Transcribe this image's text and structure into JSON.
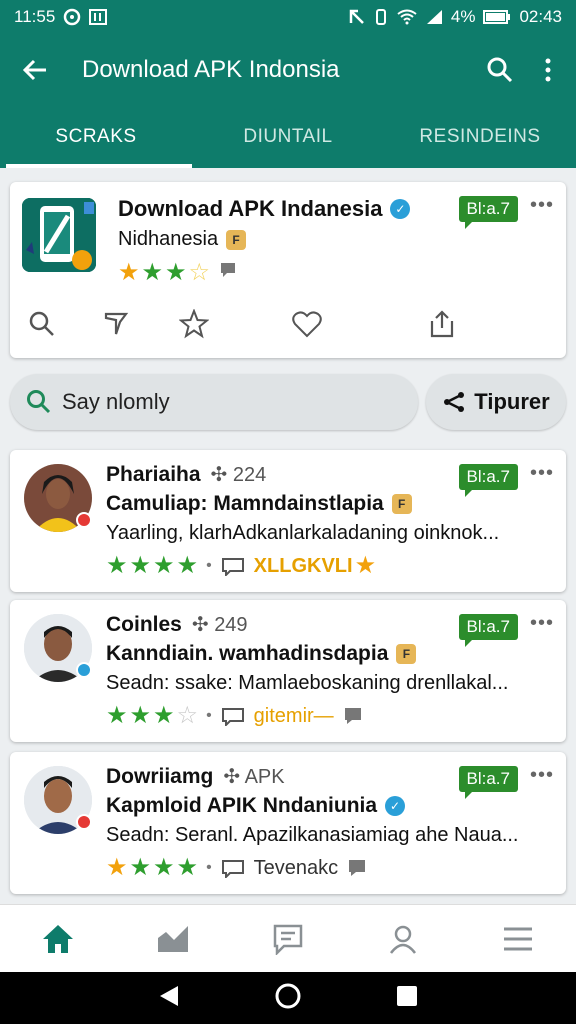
{
  "status_bar": {
    "time": "11:55",
    "battery": "4%",
    "clock": "02:43"
  },
  "app_bar": {
    "title": "Download APK Indonsia"
  },
  "tabs": [
    {
      "label": "SCRAKS",
      "active": true
    },
    {
      "label": "DIUNTAIL",
      "active": false
    },
    {
      "label": "RESINDEINS",
      "active": false
    }
  ],
  "app_card": {
    "title": "Download APK Indanesia",
    "subtitle": "Nidhanesia",
    "price": "Bl:a.7",
    "rating": 3.5
  },
  "search": {
    "value": "Say nlomly"
  },
  "share": {
    "label": "Tipurer"
  },
  "reviews": [
    {
      "name": "Phariaiha",
      "meta": "224",
      "title": "Camuliap: Mamndainstlapia",
      "text": "Yaarling, klarhAdkanlarkaladaning oinknok...",
      "rating": 4,
      "extra": "XLLGKVLI",
      "price": "Bl:a.7"
    },
    {
      "name": "Coinles",
      "meta": "249",
      "title": "Kanndiain. wamhadinsdapia",
      "text": "Seadn: ssake: Mamlaeboskaning drenllakal...",
      "rating": 3,
      "extra": "gitemir—",
      "price": "Bl:a.7"
    },
    {
      "name": "Dowriiamg",
      "meta": "APK",
      "title": "Kapmloid APIK Nndaniunia",
      "text": "Seadn: Seranl. Apazilkanasiamiag ahe Naua...",
      "rating": 4,
      "extra": "Tevenakc",
      "price": "Bl:a.7"
    }
  ],
  "colors": {
    "primary": "#0e7c6b",
    "accent_green": "#2c8d2c",
    "star_orange": "#f2a10c"
  }
}
